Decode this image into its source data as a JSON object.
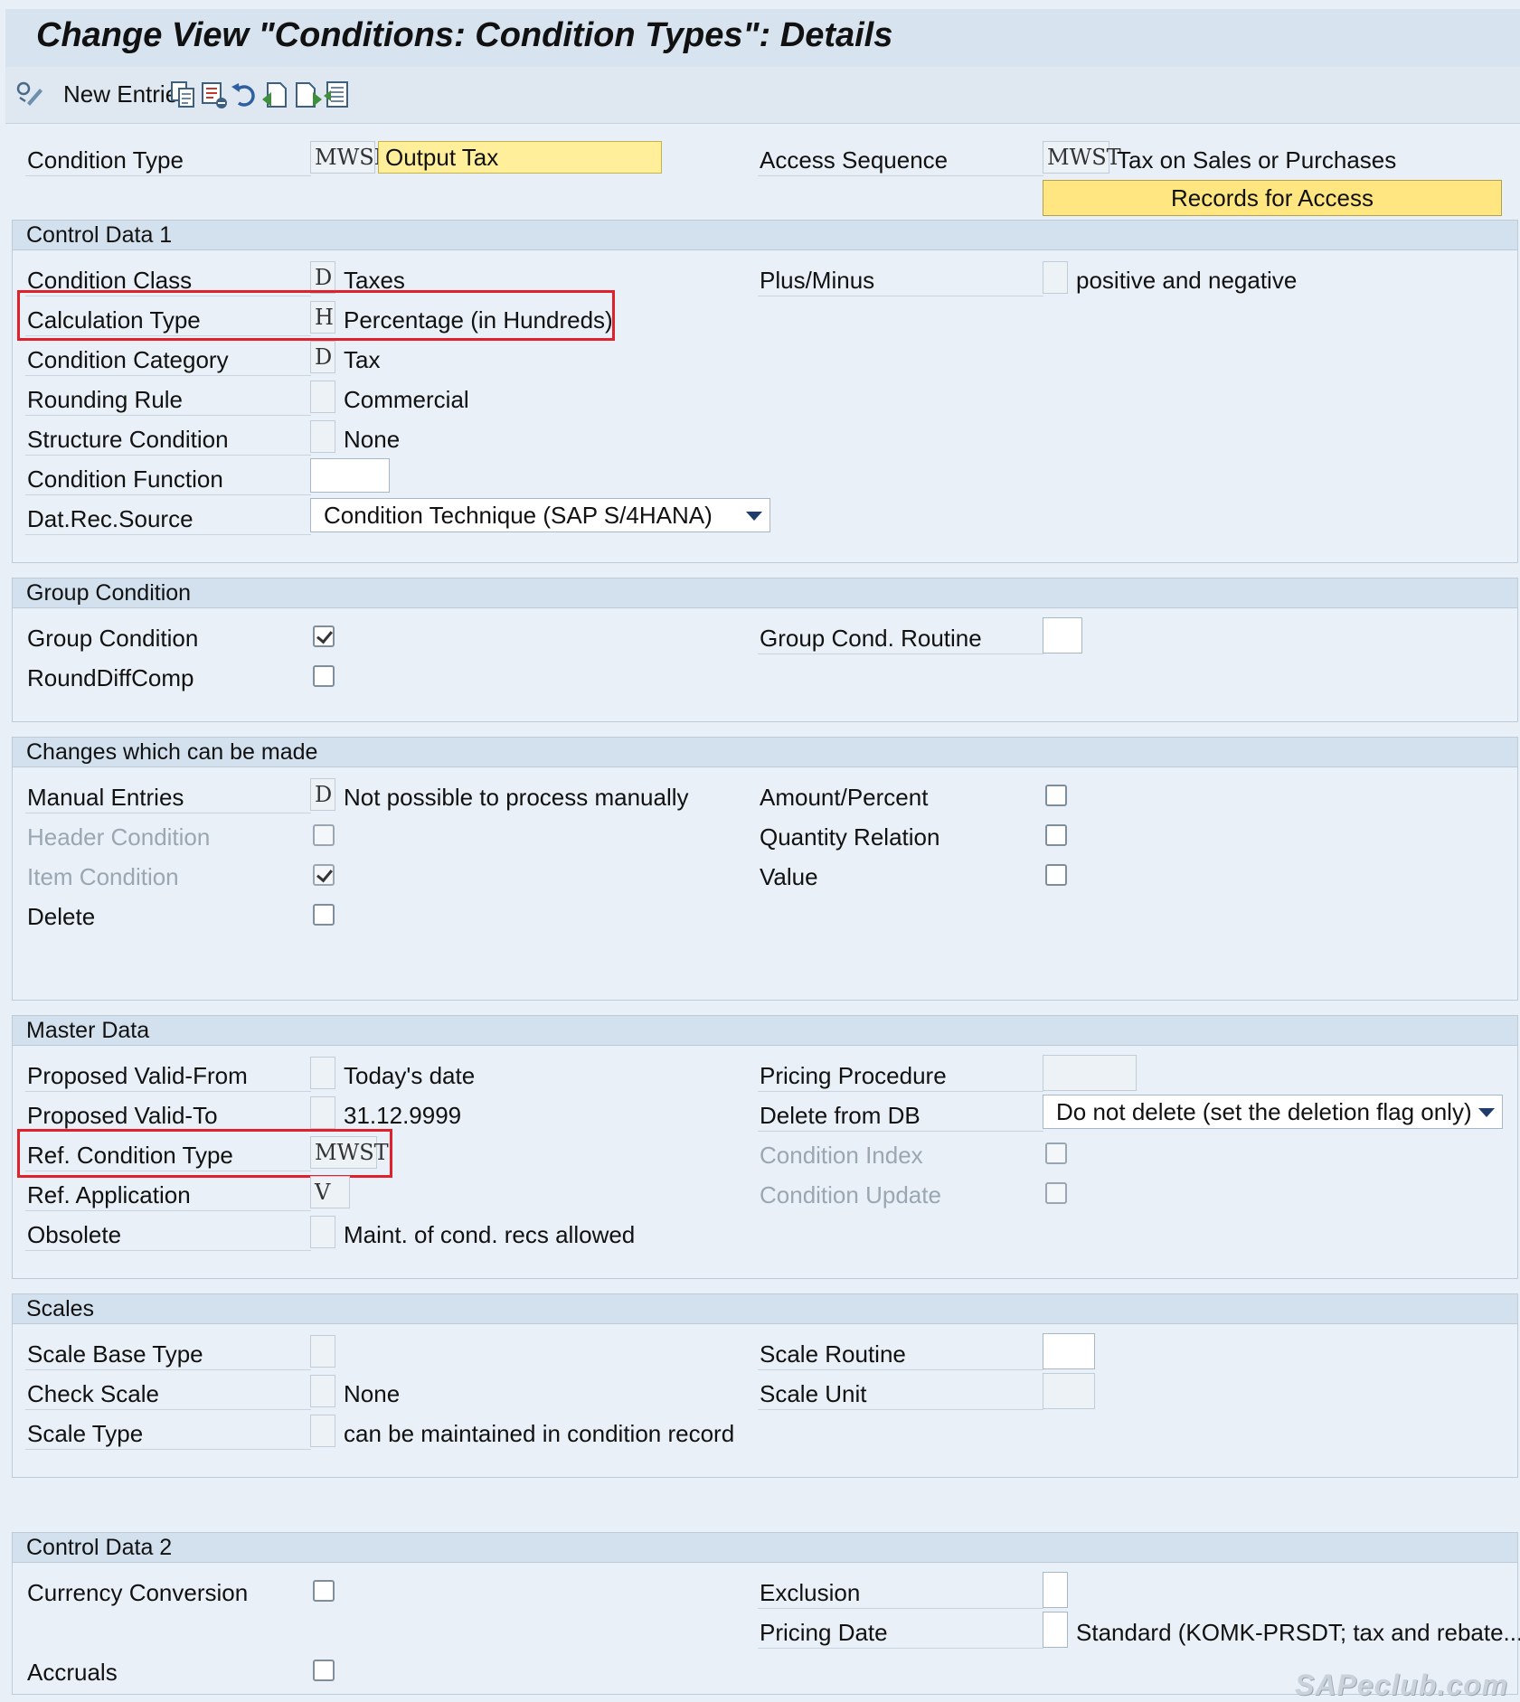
{
  "window": {
    "title": "Change View \"Conditions: Condition Types\": Details"
  },
  "toolbar": {
    "new_entries": "New Entries"
  },
  "top": {
    "cond_type_label": "Condition Type",
    "cond_type_code": "MWSI",
    "cond_type_desc": "Output Tax",
    "access_seq_label": "Access Sequence",
    "access_seq_code": "MWST",
    "access_seq_desc": "Tax on Sales or Purchases",
    "records_button": "Records for Access"
  },
  "control1": {
    "title": "Control Data 1",
    "cond_class_label": "Condition Class",
    "cond_class_code": "D",
    "cond_class_desc": "Taxes",
    "plus_minus_label": "Plus/Minus",
    "plus_minus_desc": "positive and negative",
    "calc_type_label": "Calculation Type",
    "calc_type_code": "H",
    "calc_type_desc": "Percentage (in Hundreds)",
    "cond_cat_label": "Condition Category",
    "cond_cat_code": "D",
    "cond_cat_desc": "Tax",
    "rounding_label": "Rounding Rule",
    "rounding_desc": "Commercial",
    "structure_label": "Structure Condition",
    "structure_desc": "None",
    "function_label": "Condition Function",
    "datrec_label": "Dat.Rec.Source",
    "datrec_value": "Condition Technique (SAP S/4HANA)"
  },
  "group": {
    "title": "Group Condition",
    "group_cond_label": "Group Condition",
    "group_cond_checked": true,
    "group_routine_label": "Group Cond. Routine",
    "rounddiff_label": "RoundDiffComp",
    "rounddiff_checked": false
  },
  "changes": {
    "title": "Changes which can be made",
    "manual_label": "Manual Entries",
    "manual_code": "D",
    "manual_desc": "Not possible to process manually",
    "amount_label": "Amount/Percent",
    "header_label": "Header Condition",
    "quantity_label": "Quantity Relation",
    "item_label": "Item Condition",
    "item_checked": true,
    "value_label": "Value",
    "delete_label": "Delete"
  },
  "master": {
    "title": "Master Data",
    "valid_from_label": "Proposed Valid-From",
    "valid_from_desc": "Today's date",
    "pricing_proc_label": "Pricing Procedure",
    "valid_to_label": "Proposed Valid-To",
    "valid_to_desc": "31.12.9999",
    "delete_db_label": "Delete from DB",
    "delete_db_value": "Do not delete (set the deletion flag only)",
    "ref_cond_label": "Ref. Condition Type",
    "ref_cond_code": "MWST",
    "cond_index_label": "Condition Index",
    "ref_app_label": "Ref. Application",
    "ref_app_code": "V",
    "cond_update_label": "Condition Update",
    "obsolete_label": "Obsolete",
    "obsolete_desc": "Maint. of cond. recs allowed"
  },
  "scales": {
    "title": "Scales",
    "base_type_label": "Scale Base Type",
    "routine_label": "Scale Routine",
    "check_label": "Check Scale",
    "check_desc": "None",
    "unit_label": "Scale Unit",
    "type_label": "Scale Type",
    "type_desc": "can be maintained in condition record"
  },
  "control2": {
    "title": "Control Data 2",
    "currency_label": "Currency Conversion",
    "exclusion_label": "Exclusion",
    "pricing_date_label": "Pricing Date",
    "pricing_date_desc": "Standard (KOMK-PRSDT; tax and rebate...",
    "accruals_label": "Accruals"
  },
  "watermark": "SAPeclub.com",
  "colors": {
    "highlight": "#e0202a",
    "yellow": "#ffef9a",
    "section_header": "#d3e1ee"
  }
}
